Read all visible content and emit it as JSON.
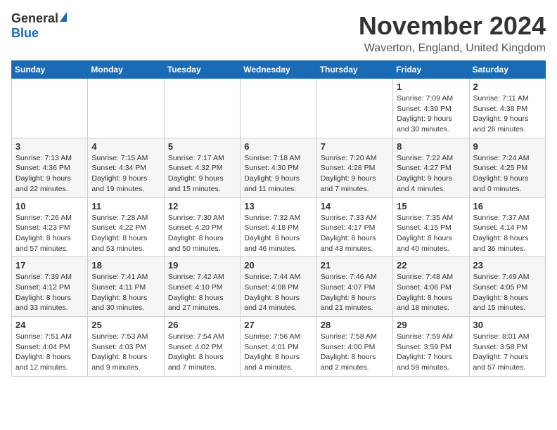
{
  "header": {
    "logo_general": "General",
    "logo_blue": "Blue",
    "month_title": "November 2024",
    "location": "Waverton, England, United Kingdom"
  },
  "weekdays": [
    "Sunday",
    "Monday",
    "Tuesday",
    "Wednesday",
    "Thursday",
    "Friday",
    "Saturday"
  ],
  "weeks": [
    [
      {
        "day": "",
        "info": ""
      },
      {
        "day": "",
        "info": ""
      },
      {
        "day": "",
        "info": ""
      },
      {
        "day": "",
        "info": ""
      },
      {
        "day": "",
        "info": ""
      },
      {
        "day": "1",
        "info": "Sunrise: 7:09 AM\nSunset: 4:39 PM\nDaylight: 9 hours\nand 30 minutes."
      },
      {
        "day": "2",
        "info": "Sunrise: 7:11 AM\nSunset: 4:38 PM\nDaylight: 9 hours\nand 26 minutes."
      }
    ],
    [
      {
        "day": "3",
        "info": "Sunrise: 7:13 AM\nSunset: 4:36 PM\nDaylight: 9 hours\nand 22 minutes."
      },
      {
        "day": "4",
        "info": "Sunrise: 7:15 AM\nSunset: 4:34 PM\nDaylight: 9 hours\nand 19 minutes."
      },
      {
        "day": "5",
        "info": "Sunrise: 7:17 AM\nSunset: 4:32 PM\nDaylight: 9 hours\nand 15 minutes."
      },
      {
        "day": "6",
        "info": "Sunrise: 7:18 AM\nSunset: 4:30 PM\nDaylight: 9 hours\nand 11 minutes."
      },
      {
        "day": "7",
        "info": "Sunrise: 7:20 AM\nSunset: 4:28 PM\nDaylight: 9 hours\nand 7 minutes."
      },
      {
        "day": "8",
        "info": "Sunrise: 7:22 AM\nSunset: 4:27 PM\nDaylight: 9 hours\nand 4 minutes."
      },
      {
        "day": "9",
        "info": "Sunrise: 7:24 AM\nSunset: 4:25 PM\nDaylight: 9 hours\nand 0 minutes."
      }
    ],
    [
      {
        "day": "10",
        "info": "Sunrise: 7:26 AM\nSunset: 4:23 PM\nDaylight: 8 hours\nand 57 minutes."
      },
      {
        "day": "11",
        "info": "Sunrise: 7:28 AM\nSunset: 4:22 PM\nDaylight: 8 hours\nand 53 minutes."
      },
      {
        "day": "12",
        "info": "Sunrise: 7:30 AM\nSunset: 4:20 PM\nDaylight: 8 hours\nand 50 minutes."
      },
      {
        "day": "13",
        "info": "Sunrise: 7:32 AM\nSunset: 4:18 PM\nDaylight: 8 hours\nand 46 minutes."
      },
      {
        "day": "14",
        "info": "Sunrise: 7:33 AM\nSunset: 4:17 PM\nDaylight: 8 hours\nand 43 minutes."
      },
      {
        "day": "15",
        "info": "Sunrise: 7:35 AM\nSunset: 4:15 PM\nDaylight: 8 hours\nand 40 minutes."
      },
      {
        "day": "16",
        "info": "Sunrise: 7:37 AM\nSunset: 4:14 PM\nDaylight: 8 hours\nand 36 minutes."
      }
    ],
    [
      {
        "day": "17",
        "info": "Sunrise: 7:39 AM\nSunset: 4:12 PM\nDaylight: 8 hours\nand 33 minutes."
      },
      {
        "day": "18",
        "info": "Sunrise: 7:41 AM\nSunset: 4:11 PM\nDaylight: 8 hours\nand 30 minutes."
      },
      {
        "day": "19",
        "info": "Sunrise: 7:42 AM\nSunset: 4:10 PM\nDaylight: 8 hours\nand 27 minutes."
      },
      {
        "day": "20",
        "info": "Sunrise: 7:44 AM\nSunset: 4:08 PM\nDaylight: 8 hours\nand 24 minutes."
      },
      {
        "day": "21",
        "info": "Sunrise: 7:46 AM\nSunset: 4:07 PM\nDaylight: 8 hours\nand 21 minutes."
      },
      {
        "day": "22",
        "info": "Sunrise: 7:48 AM\nSunset: 4:06 PM\nDaylight: 8 hours\nand 18 minutes."
      },
      {
        "day": "23",
        "info": "Sunrise: 7:49 AM\nSunset: 4:05 PM\nDaylight: 8 hours\nand 15 minutes."
      }
    ],
    [
      {
        "day": "24",
        "info": "Sunrise: 7:51 AM\nSunset: 4:04 PM\nDaylight: 8 hours\nand 12 minutes."
      },
      {
        "day": "25",
        "info": "Sunrise: 7:53 AM\nSunset: 4:03 PM\nDaylight: 8 hours\nand 9 minutes."
      },
      {
        "day": "26",
        "info": "Sunrise: 7:54 AM\nSunset: 4:02 PM\nDaylight: 8 hours\nand 7 minutes."
      },
      {
        "day": "27",
        "info": "Sunrise: 7:56 AM\nSunset: 4:01 PM\nDaylight: 8 hours\nand 4 minutes."
      },
      {
        "day": "28",
        "info": "Sunrise: 7:58 AM\nSunset: 4:00 PM\nDaylight: 8 hours\nand 2 minutes."
      },
      {
        "day": "29",
        "info": "Sunrise: 7:59 AM\nSunset: 3:59 PM\nDaylight: 7 hours\nand 59 minutes."
      },
      {
        "day": "30",
        "info": "Sunrise: 8:01 AM\nSunset: 3:58 PM\nDaylight: 7 hours\nand 57 minutes."
      }
    ]
  ]
}
